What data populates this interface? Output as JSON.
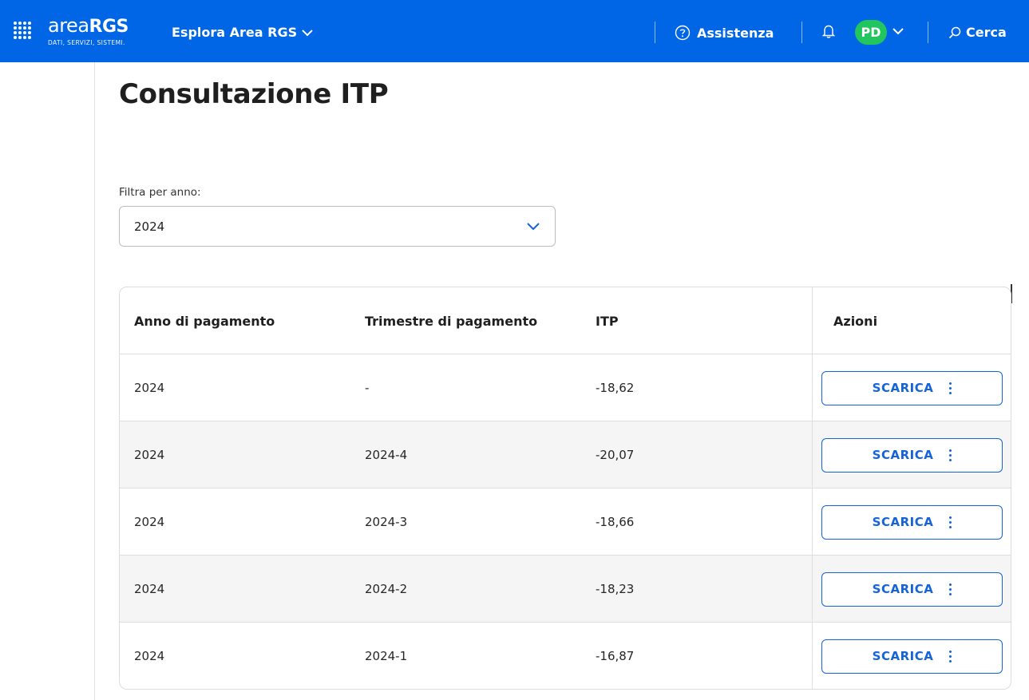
{
  "header": {
    "logo_word_a": "area",
    "logo_word_b": "RGS",
    "logo_tagline": "DATI, SERVIZI, SISTEMI.",
    "explore_label": "Esplora Area RGS",
    "assist_label": "Assistenza",
    "avatar_initials": "PD",
    "search_label": "Cerca"
  },
  "page": {
    "title": "Consultazione ITP"
  },
  "filter": {
    "label": "Filtra per anno:",
    "selected": "2024"
  },
  "table": {
    "columns": [
      "Anno di pagamento",
      "Trimestre di pagamento",
      "ITP",
      "Azioni"
    ],
    "rows": [
      {
        "anno": "2024",
        "trimestre": "-",
        "itp": "-18,62",
        "action": "SCARICA"
      },
      {
        "anno": "2024",
        "trimestre": "2024-4",
        "itp": "-20,07",
        "action": "SCARICA"
      },
      {
        "anno": "2024",
        "trimestre": "2024-3",
        "itp": "-18,66",
        "action": "SCARICA"
      },
      {
        "anno": "2024",
        "trimestre": "2024-2",
        "itp": "-18,23",
        "action": "SCARICA"
      },
      {
        "anno": "2024",
        "trimestre": "2024-1",
        "itp": "-16,87",
        "action": "SCARICA"
      }
    ]
  },
  "colors": {
    "header_bg": "#0066e6",
    "avatar_bg": "#22c55e",
    "button_accent": "#1463d8",
    "row_alt_bg": "#f5f5f5"
  },
  "icons": {
    "apps": "apps-grid-icon",
    "explore_chevron": "chevron-down-icon",
    "assist": "help-circle-icon",
    "bell": "bell-icon",
    "search": "search-icon",
    "select_chevron": "chevron-down-icon",
    "row_menu": "kebab-menu-icon"
  }
}
